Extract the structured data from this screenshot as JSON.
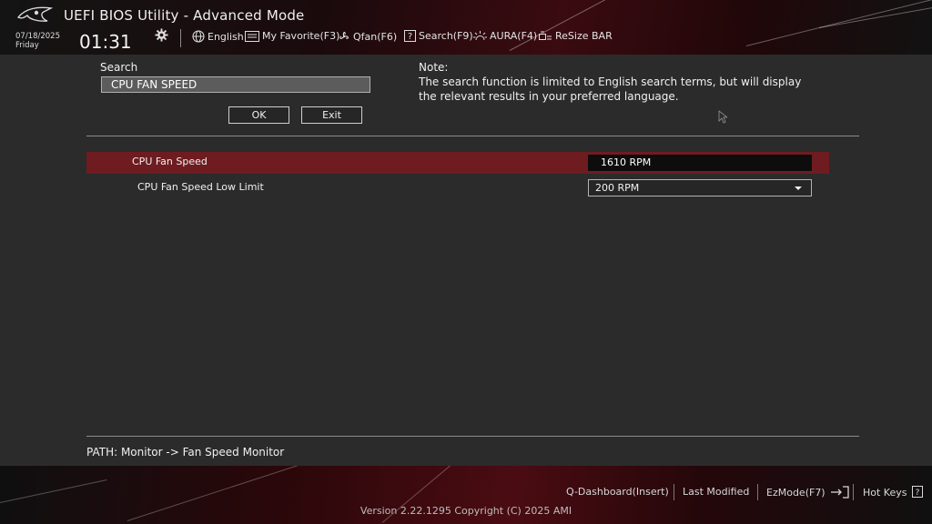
{
  "header": {
    "title": "UEFI BIOS Utility - Advanced Mode",
    "date": "07/18/2025",
    "day": "Friday",
    "time": "01:31",
    "toolbar": {
      "language": "English",
      "my_favorite": "My Favorite(F3)",
      "qfan": "Qfan(F6)",
      "search": "Search(F9)",
      "aura": "AURA(F4)",
      "resize_bar": "ReSize BAR"
    }
  },
  "search": {
    "label": "Search",
    "value": "CPU FAN SPEED",
    "ok_label": "OK",
    "exit_label": "Exit"
  },
  "note": {
    "title": "Note:",
    "text": "The search function is limited to English search terms, but will display the relevant results in your preferred language."
  },
  "results": [
    {
      "label": "CPU Fan Speed",
      "value": "1610 RPM",
      "selected": true
    },
    {
      "label": "CPU Fan Speed Low Limit",
      "value": "200 RPM",
      "selected": false
    }
  ],
  "path": "PATH: Monitor -> Fan Speed Monitor",
  "footer": {
    "q_dashboard": "Q-Dashboard(Insert)",
    "last_modified": "Last Modified",
    "ezmode": "EzMode(F7)",
    "hot_keys": "Hot Keys",
    "version": "Version 2.22.1295 Copyright (C) 2025 AMI"
  },
  "colors": {
    "accent_red": "#6e1c20",
    "background": "#2b2b2b"
  }
}
